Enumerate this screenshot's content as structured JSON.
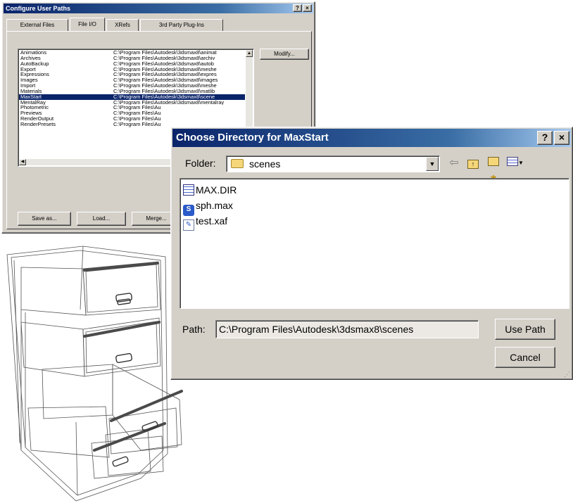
{
  "config_window": {
    "title": "Configure User Paths",
    "title_buttons": [
      "?",
      "×"
    ],
    "tabs": [
      "External Files",
      "File I/O",
      "XRefs",
      "3rd Party Plug-Ins"
    ],
    "modify_label": "Modify...",
    "paths": [
      {
        "name": "Animations",
        "path": "C:\\Program Files\\Autodesk\\3dsmax8\\animat"
      },
      {
        "name": "Archives",
        "path": "C:\\Program Files\\Autodesk\\3dsmax8\\archiv"
      },
      {
        "name": "AutoBackup",
        "path": "C:\\Program Files\\Autodesk\\3dsmax8\\autob"
      },
      {
        "name": "Export",
        "path": "C:\\Program Files\\Autodesk\\3dsmax8\\meshe"
      },
      {
        "name": "Expressions",
        "path": "C:\\Program Files\\Autodesk\\3dsmax8\\expres"
      },
      {
        "name": "Images",
        "path": "C:\\Program Files\\Autodesk\\3dsmax8\\images"
      },
      {
        "name": "Import",
        "path": "C:\\Program Files\\Autodesk\\3dsmax8\\meshe"
      },
      {
        "name": "Materials",
        "path": "C:\\Program Files\\Autodesk\\3dsmax8\\matlib"
      },
      {
        "name": "MaxStart",
        "path": "C:\\Program Files\\Autodesk\\3dsmax8\\scene",
        "selected": true
      },
      {
        "name": "MentalRay",
        "path": "C:\\Program Files\\Autodesk\\3dsmax8\\mentalray"
      },
      {
        "name": "Photometric",
        "path": "C:\\Program Files\\Au"
      },
      {
        "name": "Previews",
        "path": "C:\\Program Files\\Au"
      },
      {
        "name": "RenderOutput",
        "path": "C:\\Program Files\\Au"
      },
      {
        "name": "RenderPresets",
        "path": "C:\\Program Files\\Au"
      }
    ],
    "buttons": {
      "save": "Save as...",
      "load": "Load...",
      "merge": "Merge..."
    }
  },
  "choose_dialog": {
    "title": "Choose Directory for MaxStart",
    "title_buttons": [
      "?",
      "×"
    ],
    "folder_label": "Folder:",
    "folder_value": "scenes",
    "toolbar_icons": [
      "back-arrow-icon",
      "up-folder-icon",
      "new-folder-icon",
      "view-menu-icon"
    ],
    "files": [
      {
        "name": "MAX.DIR",
        "icon": "dir-file-icon"
      },
      {
        "name": "sph.max",
        "icon": "max-file-icon"
      },
      {
        "name": "test.xaf",
        "icon": "xaf-file-icon"
      }
    ],
    "path_label": "Path:",
    "path_value": "C:\\Program Files\\Autodesk\\3dsmax8\\scenes",
    "use_path_label": "Use Path",
    "cancel_label": "Cancel"
  },
  "colors": {
    "title_bar": "#0a246a",
    "selection": "#0a246a",
    "face": "#d4d0c8"
  }
}
